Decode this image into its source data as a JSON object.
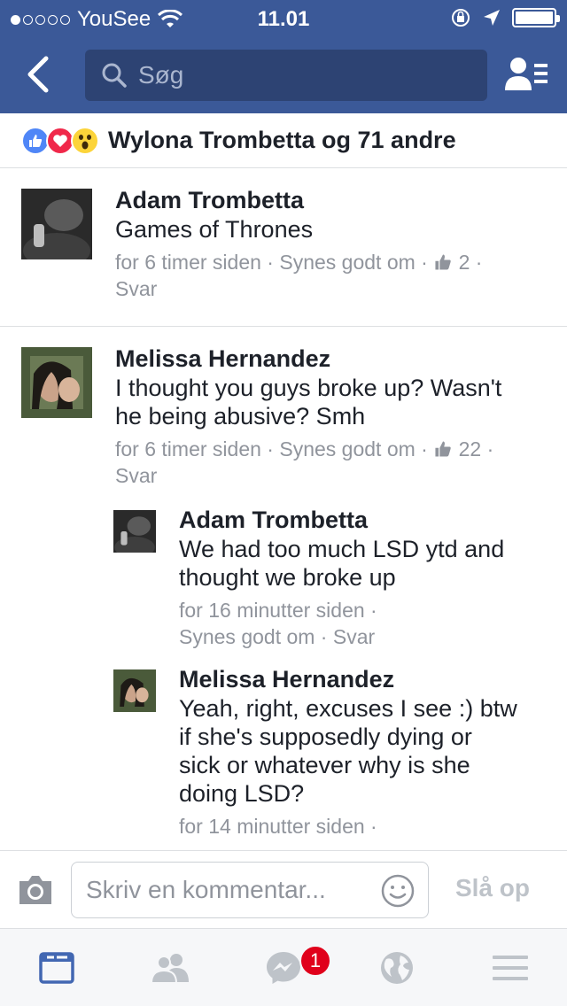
{
  "status_bar": {
    "carrier": "YouSee",
    "time": "11.01",
    "signal_dots_filled": 1,
    "signal_dots_total": 5,
    "battery_level": 1.0
  },
  "nav": {
    "search_placeholder": "Søg",
    "icons": [
      "back-chevron-icon",
      "search-icon",
      "friend-requests-icon"
    ]
  },
  "reactions": {
    "icons": [
      "like-icon",
      "love-icon",
      "wow-icon"
    ],
    "summary": "Wylona Trombetta og 71 andre"
  },
  "comments": [
    {
      "name": "Adam Trombetta",
      "text": "Games of Thrones",
      "time": "for 6 timer siden",
      "like_label": "Synes godt om",
      "like_count": "2",
      "reply_label": "Svar"
    },
    {
      "name": "Melissa Hernandez",
      "text_lines": [
        "I thought you guys broke up? Wasn't",
        "he being abusive? Smh"
      ],
      "time": "for 6 timer siden",
      "like_label": "Synes godt om",
      "like_count": "22",
      "reply_label": "Svar",
      "replies": [
        {
          "name": "Adam Trombetta",
          "text_lines": [
            "We had too much LSD ytd and",
            "thought we broke up"
          ],
          "time": "for 16 minutter siden",
          "like_label": "Synes godt om",
          "reply_label": "Svar"
        },
        {
          "name": "Melissa Hernandez",
          "text_lines": [
            "Yeah, right, excuses I see :) btw",
            "if she's supposedly dying or",
            "sick or whatever why is she",
            "doing LSD?"
          ],
          "time": "for 14 minutter siden"
        }
      ]
    }
  ],
  "composer": {
    "placeholder": "Skriv en kommentar...",
    "post_label": "Slå op"
  },
  "tabbar": {
    "tabs": [
      "news-feed-icon",
      "friends-icon",
      "messenger-icon",
      "notifications-globe-icon",
      "menu-icon"
    ],
    "messenger_badge": "1",
    "active_color": "#4267b2",
    "inactive_color": "#bec3c9"
  },
  "colors": {
    "brand_blue": "#3b5998",
    "meta_gray": "#90949c"
  }
}
